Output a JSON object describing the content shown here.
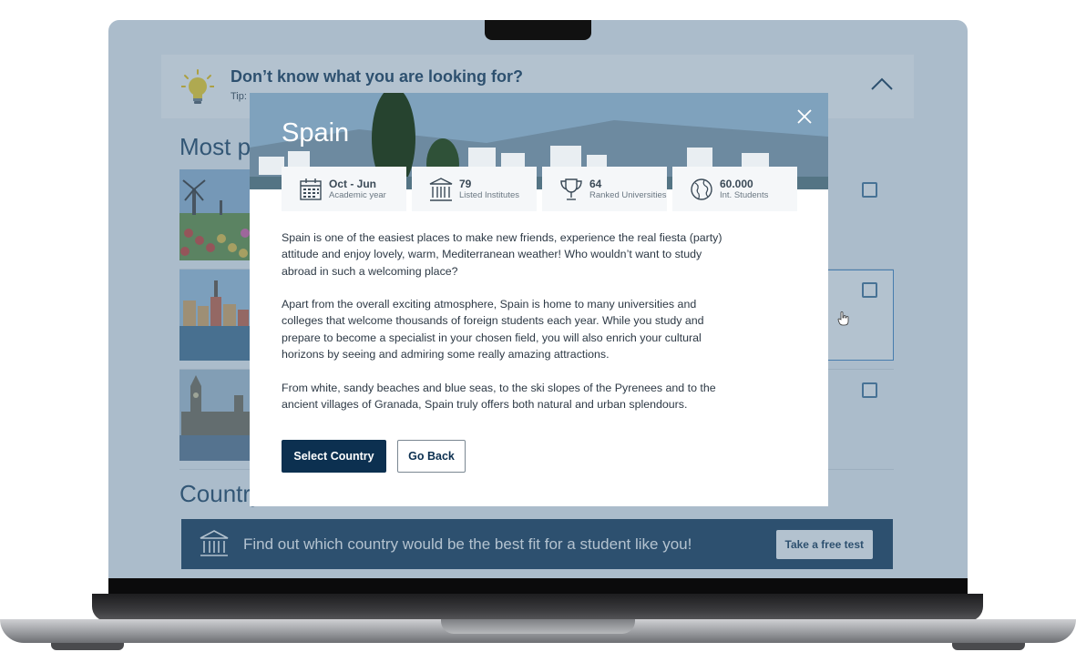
{
  "tip": {
    "title": "Don’t know what you are looking for?",
    "text": "Tip:"
  },
  "sections": {
    "most_popular_heading": "Most p",
    "countries_heading": "Country"
  },
  "banner": {
    "text": "Find out which country would be the best fit for a student like you!",
    "button_label": "Take a free test"
  },
  "modal": {
    "title": "Spain",
    "stats": [
      {
        "value": "Oct - Jun",
        "label": "Academic year",
        "icon": "calendar-icon"
      },
      {
        "value": "79",
        "label": "Listed Institutes",
        "icon": "institute-icon"
      },
      {
        "value": "64",
        "label": "Ranked Universities",
        "icon": "trophy-icon"
      },
      {
        "value": "60.000",
        "label": "Int. Students",
        "icon": "globe-icon"
      }
    ],
    "paragraphs": [
      "Spain is one of the easiest places to make new friends, experience the real fiesta (party) attitude and enjoy lovely, warm, Mediterranean weather! Who wouldn’t want to study abroad in such a welcoming place?",
      "Apart from the overall exciting atmosphere, Spain is home to many universities and colleges that welcome thousands of foreign students each year. While you study and prepare to become a specialist in your chosen field, you will also enrich your cultural horizons by seeing and admiring some really amazing attractions.",
      "From white, sandy beaches and blue seas, to the ski slopes of the Pyrenees and to the ancient villages of Granada, Spain truly offers both natural and urban splendours."
    ],
    "primary_button": "Select Country",
    "secondary_button": "Go Back"
  },
  "colors": {
    "navy": "#0c3050",
    "overlay": "#567894",
    "accent_blue": "#3b82c4"
  }
}
